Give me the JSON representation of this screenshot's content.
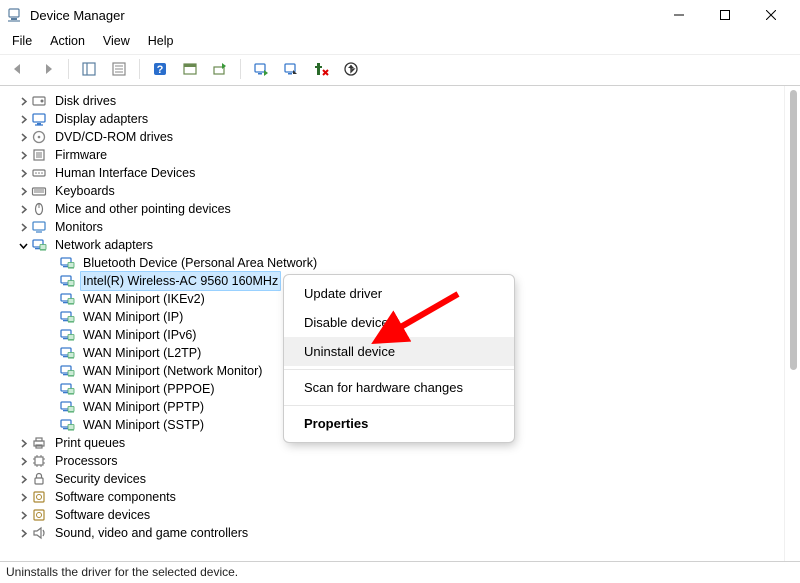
{
  "window": {
    "title": "Device Manager"
  },
  "menubar": [
    "File",
    "Action",
    "View",
    "Help"
  ],
  "tree": {
    "categories": [
      {
        "label": "Disk drives",
        "iconType": "disk",
        "expanded": false
      },
      {
        "label": "Display adapters",
        "iconType": "display",
        "expanded": false
      },
      {
        "label": "DVD/CD-ROM drives",
        "iconType": "cd",
        "expanded": false
      },
      {
        "label": "Firmware",
        "iconType": "firmware",
        "expanded": false
      },
      {
        "label": "Human Interface Devices",
        "iconType": "hid",
        "expanded": false
      },
      {
        "label": "Keyboards",
        "iconType": "keyboard",
        "expanded": false
      },
      {
        "label": "Mice and other pointing devices",
        "iconType": "mouse",
        "expanded": false
      },
      {
        "label": "Monitors",
        "iconType": "monitor",
        "expanded": false
      },
      {
        "label": "Network adapters",
        "iconType": "network",
        "expanded": true,
        "children": [
          {
            "label": "Bluetooth Device (Personal Area Network)",
            "iconType": "network",
            "selected": false
          },
          {
            "label": "Intel(R) Wireless-AC 9560 160MHz",
            "iconType": "network",
            "selected": true
          },
          {
            "label": "WAN Miniport (IKEv2)",
            "iconType": "network",
            "selected": false
          },
          {
            "label": "WAN Miniport (IP)",
            "iconType": "network",
            "selected": false
          },
          {
            "label": "WAN Miniport (IPv6)",
            "iconType": "network",
            "selected": false
          },
          {
            "label": "WAN Miniport (L2TP)",
            "iconType": "network",
            "selected": false
          },
          {
            "label": "WAN Miniport (Network Monitor)",
            "iconType": "network",
            "selected": false
          },
          {
            "label": "WAN Miniport (PPPOE)",
            "iconType": "network",
            "selected": false
          },
          {
            "label": "WAN Miniport (PPTP)",
            "iconType": "network",
            "selected": false
          },
          {
            "label": "WAN Miniport (SSTP)",
            "iconType": "network",
            "selected": false
          }
        ]
      },
      {
        "label": "Print queues",
        "iconType": "printer",
        "expanded": false
      },
      {
        "label": "Processors",
        "iconType": "cpu",
        "expanded": false
      },
      {
        "label": "Security devices",
        "iconType": "security",
        "expanded": false
      },
      {
        "label": "Software components",
        "iconType": "software",
        "expanded": false
      },
      {
        "label": "Software devices",
        "iconType": "software",
        "expanded": false
      },
      {
        "label": "Sound, video and game controllers",
        "iconType": "sound",
        "expanded": false
      }
    ]
  },
  "context_menu": {
    "items": [
      {
        "label": "Update driver",
        "bold": false,
        "highlighted": false
      },
      {
        "label": "Disable device",
        "bold": false,
        "highlighted": false
      },
      {
        "label": "Uninstall device",
        "bold": false,
        "highlighted": true
      },
      {
        "separator": true
      },
      {
        "label": "Scan for hardware changes",
        "bold": false,
        "highlighted": false
      },
      {
        "separator": true
      },
      {
        "label": "Properties",
        "bold": true,
        "highlighted": false
      }
    ]
  },
  "statusbar": {
    "text": "Uninstalls the driver for the selected device."
  },
  "annotation": {
    "arrow_color": "#ff0000"
  }
}
